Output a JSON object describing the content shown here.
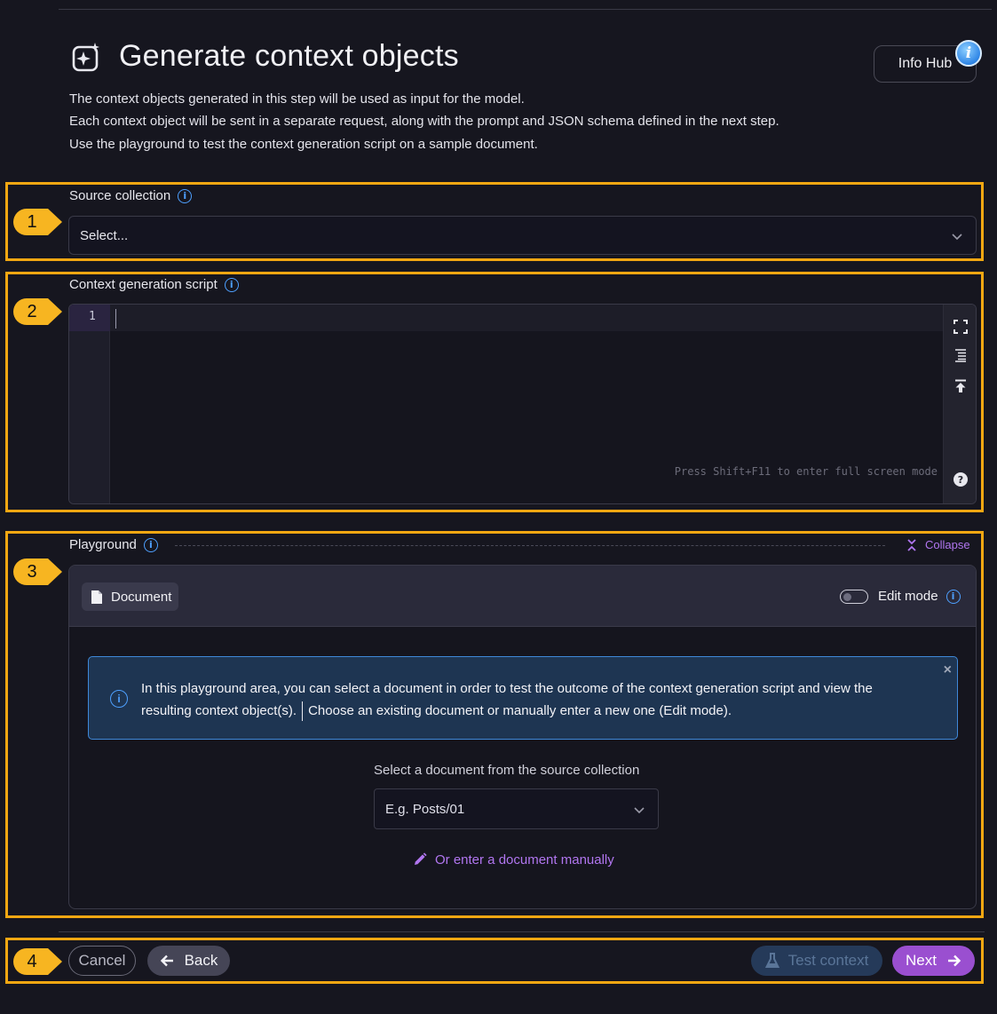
{
  "header": {
    "title": "Generate context objects",
    "description_lines": [
      "The context objects generated in this step will be used as input for the model.",
      "Each context object will be sent in a separate request, along with the prompt and JSON schema defined in the next step.",
      "Use the playground to test the context generation script on a sample document."
    ],
    "info_hub_label": "Info Hub",
    "info_badge": "i"
  },
  "steps": [
    "1",
    "2",
    "3",
    "4"
  ],
  "source_collection": {
    "label": "Source collection",
    "value": "Select..."
  },
  "script_editor": {
    "label": "Context generation script",
    "line_numbers": [
      "1"
    ],
    "hint": "Press Shift+F11 to enter full screen mode",
    "help_glyph": "?"
  },
  "playground": {
    "title": "Playground",
    "collapse_label": "Collapse",
    "document_tab_label": "Document",
    "edit_mode_label": "Edit mode",
    "edit_mode_on": false,
    "alert": {
      "text_part1": "In this playground area, you can select a document in order to test the outcome of the context generation script and view the resulting context object(s).",
      "text_part2": "Choose an existing document or manually enter a new one (Edit mode).",
      "close_glyph": "×"
    },
    "doc_select_label": "Select a document from the source collection",
    "doc_select_placeholder": "E.g. Posts/01",
    "manual_link": "Or enter a document manually"
  },
  "footer": {
    "cancel_label": "Cancel",
    "back_label": "Back",
    "test_label": "Test context",
    "next_label": "Next"
  },
  "colors": {
    "background": "#16161f",
    "highlight_border": "#f3a712",
    "accent_purple": "#9a4fd0",
    "info_blue": "#4ea0ff"
  }
}
